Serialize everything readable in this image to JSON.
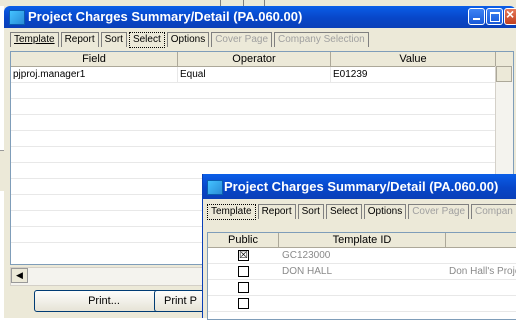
{
  "main_window": {
    "title": "Project Charges Summary/Detail (PA.060.00)",
    "tabs": [
      {
        "label": "Template",
        "state": "normal"
      },
      {
        "label": "Report",
        "state": "normal"
      },
      {
        "label": "Sort",
        "state": "normal"
      },
      {
        "label": "Select",
        "state": "active"
      },
      {
        "label": "Options",
        "state": "normal"
      },
      {
        "label": "Cover Page",
        "state": "disabled"
      },
      {
        "label": "Company Selection",
        "state": "disabled"
      }
    ],
    "grid": {
      "columns": [
        "Field",
        "Operator",
        "Value"
      ],
      "rows": [
        {
          "field": "pjproj.manager1",
          "operator": "Equal",
          "value": "E01239"
        }
      ]
    },
    "buttons": {
      "print": "Print...",
      "print_preview": "Print P"
    }
  },
  "template_window": {
    "title": "Project Charges Summary/Detail (PA.060.00)",
    "tabs": [
      {
        "label": "Template",
        "state": "active"
      },
      {
        "label": "Report",
        "state": "normal"
      },
      {
        "label": "Sort",
        "state": "normal"
      },
      {
        "label": "Select",
        "state": "normal"
      },
      {
        "label": "Options",
        "state": "normal"
      },
      {
        "label": "Cover Page",
        "state": "disabled"
      },
      {
        "label": "Compan",
        "state": "disabled"
      }
    ],
    "grid": {
      "columns": [
        "Public",
        "Template ID",
        ""
      ],
      "rows": [
        {
          "public": "☒",
          "template_id": "GC123000",
          "description": ""
        },
        {
          "public": "",
          "template_id": "DON HALL",
          "description": "Don Hall's Projec"
        },
        {
          "public": "",
          "template_id": "",
          "description": ""
        },
        {
          "public": "",
          "template_id": "",
          "description": ""
        }
      ]
    }
  },
  "colors": {
    "titlebar": "#0846c8",
    "window_face": "#ece9d8",
    "close_button": "#c2401e"
  }
}
